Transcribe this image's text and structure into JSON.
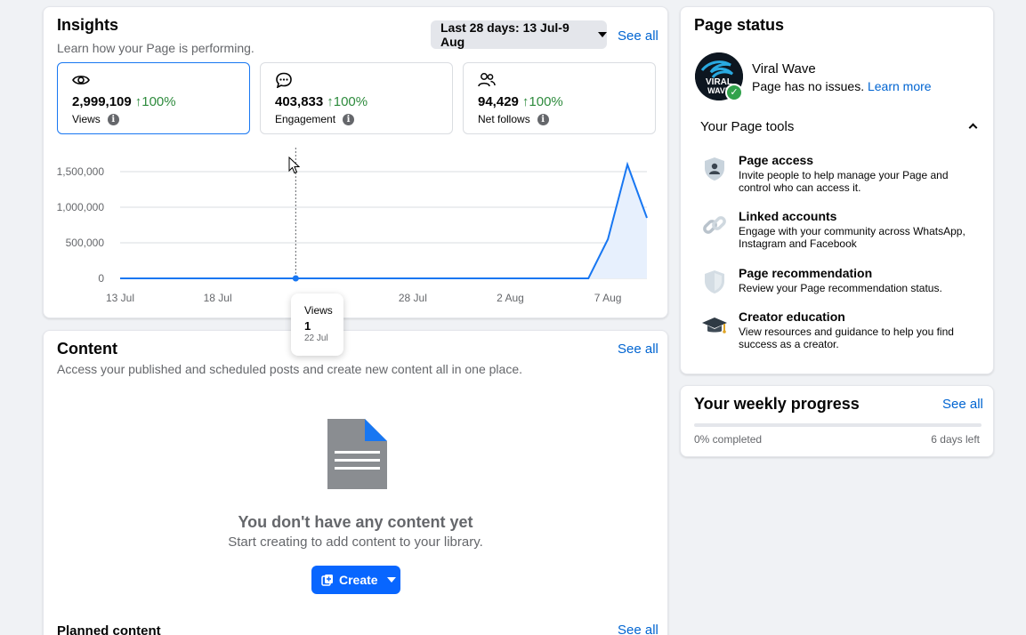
{
  "insights": {
    "title": "Insights",
    "subtitle": "Learn how your Page is performing.",
    "date_range": "Last 28 days: 13 Jul-9 Aug",
    "see_all": "See all",
    "metrics": [
      {
        "icon": "eye-icon",
        "value": "2,999,109",
        "change": "100%",
        "label": "Views",
        "active": true
      },
      {
        "icon": "chat-bubble-icon",
        "value": "403,833",
        "change": "100%",
        "label": "Engagement",
        "active": false
      },
      {
        "icon": "people-icon",
        "value": "94,429",
        "change": "100%",
        "label": "Net follows",
        "active": false
      }
    ],
    "tooltip": {
      "label": "Views",
      "value": "1",
      "date": "22 Jul"
    }
  },
  "chart_data": {
    "type": "area",
    "series": [
      {
        "name": "Views",
        "values": [
          {
            "x": "2025-07-13",
            "y": 0
          },
          {
            "x": "2025-07-22",
            "y": 1
          },
          {
            "x": "2025-08-02",
            "y": 0
          },
          {
            "x": "2025-08-06",
            "y": 0
          },
          {
            "x": "2025-08-07",
            "y": 550000
          },
          {
            "x": "2025-08-08",
            "y": 1600000
          },
          {
            "x": "2025-08-09",
            "y": 850000
          }
        ]
      }
    ],
    "x_ticks": [
      "13 Jul",
      "18 Jul",
      "28 Jul",
      "2 Aug",
      "7 Aug"
    ],
    "y_ticks": [
      "0",
      "500,000",
      "1,000,000",
      "1,500,000"
    ],
    "ylim": [
      0,
      1500000
    ],
    "grid": true,
    "hover_date": "22 Jul",
    "colors": {
      "line": "#1877f2",
      "fill": "#e7f0fd",
      "grid": "#dadde1"
    }
  },
  "content": {
    "title": "Content",
    "subtitle": "Access your published and scheduled posts and create new content all in one place.",
    "see_all": "See all",
    "empty_title": "You don't have any content yet",
    "empty_sub": "Start creating to add content to your library.",
    "create_label": "Create",
    "planned_title": "Planned content",
    "planned_see_all": "See all"
  },
  "page_status": {
    "title": "Page status",
    "page_name": "Viral Wave",
    "issues_text": "Page has no issues.",
    "learn_more": "Learn more",
    "avatar_text": "VIRAL WAVE",
    "tools_title": "Your Page tools",
    "tools": [
      {
        "icon": "shield-person-icon",
        "name": "Page access",
        "desc": "Invite people to help manage your Page and control who can access it."
      },
      {
        "icon": "link-icon",
        "name": "Linked accounts",
        "desc": "Engage with your community across WhatsApp, Instagram and Facebook"
      },
      {
        "icon": "shield-icon",
        "name": "Page recommendation",
        "desc": "Review your Page recommendation status."
      },
      {
        "icon": "graduation-cap-icon",
        "name": "Creator education",
        "desc": "View resources and guidance to help you find success as a creator."
      }
    ]
  },
  "weekly": {
    "title": "Your weekly progress",
    "see_all": "See all",
    "completed": "0% completed",
    "progress": 0,
    "days_left": "6 days left"
  }
}
